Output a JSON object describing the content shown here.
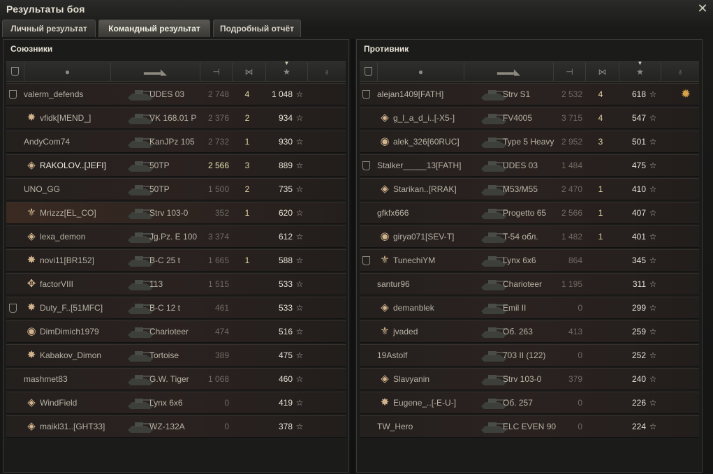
{
  "window": {
    "title": "Результаты боя",
    "close_icon": "close-icon"
  },
  "tabs": [
    {
      "label": "Личный результат",
      "active": false
    },
    {
      "label": "Командный результат",
      "active": true
    },
    {
      "label": "Подробный отчёт",
      "active": false
    }
  ],
  "header_icons": [
    "squad-icon",
    "player-icon",
    "tank-icon",
    "damage-icon",
    "kills-icon",
    "experience-star-icon",
    "medal-icon"
  ],
  "allies": {
    "title": "Союзники",
    "rows": [
      {
        "squad": true,
        "badge": "",
        "player": "valerm_defends",
        "tank": "UDES 03",
        "damage": "2 748",
        "kills": "4",
        "xp": "1 048",
        "medal": "",
        "self": false,
        "hl": false
      },
      {
        "squad": false,
        "badge": "✸",
        "player": "vfidk[MEND_]",
        "tank": "VK 168.01 P",
        "damage": "2 376",
        "kills": "2",
        "xp": "934",
        "medal": "",
        "self": false,
        "hl": false
      },
      {
        "squad": false,
        "badge": "",
        "player": "AndyCom74",
        "tank": "KanJPz 105",
        "damage": "2 732",
        "kills": "1",
        "xp": "930",
        "medal": "",
        "self": false,
        "hl": false
      },
      {
        "squad": false,
        "badge": "◈",
        "player": "RAKOLOV..[JEFI]",
        "tank": "50TP",
        "damage": "2 566",
        "kills": "3",
        "xp": "889",
        "medal": "",
        "self": false,
        "hl": true
      },
      {
        "squad": false,
        "badge": "",
        "player": "UNO_GG",
        "tank": "50TP",
        "damage": "1 500",
        "kills": "2",
        "xp": "735",
        "medal": "",
        "self": false,
        "hl": false
      },
      {
        "squad": false,
        "badge": "⚜",
        "player": "Mrizzz[EL_CO]",
        "tank": "Strv 103-0",
        "damage": "352",
        "kills": "1",
        "xp": "620",
        "medal": "",
        "self": true,
        "hl": false
      },
      {
        "squad": false,
        "badge": "◈",
        "player": "lexa_demon",
        "tank": "Jg.Pz. E 100",
        "damage": "3 374",
        "kills": "",
        "xp": "612",
        "medal": "",
        "self": false,
        "hl": false
      },
      {
        "squad": false,
        "badge": "✸",
        "player": "novi11[BR152]",
        "tank": "B-C 25 t",
        "damage": "1 665",
        "kills": "1",
        "xp": "588",
        "medal": "",
        "self": false,
        "hl": false
      },
      {
        "squad": false,
        "badge": "✥",
        "player": "factorVIII",
        "tank": "113",
        "damage": "1 515",
        "kills": "",
        "xp": "533",
        "medal": "",
        "self": false,
        "hl": false
      },
      {
        "squad": true,
        "badge": "✸",
        "player": "Duty_F..[51MFC]",
        "tank": "B-C 12 t",
        "damage": "461",
        "kills": "",
        "xp": "533",
        "medal": "",
        "self": false,
        "hl": false
      },
      {
        "squad": false,
        "badge": "◉",
        "player": "DimDimich1979",
        "tank": "Charioteer",
        "damage": "474",
        "kills": "",
        "xp": "516",
        "medal": "",
        "self": false,
        "hl": false
      },
      {
        "squad": false,
        "badge": "✸",
        "player": "Kabakov_Dimon",
        "tank": "Tortoise",
        "damage": "389",
        "kills": "",
        "xp": "475",
        "medal": "",
        "self": false,
        "hl": false
      },
      {
        "squad": false,
        "badge": "",
        "player": "mashmet83",
        "tank": "G.W. Tiger",
        "damage": "1 068",
        "kills": "",
        "xp": "460",
        "medal": "",
        "self": false,
        "hl": false
      },
      {
        "squad": false,
        "badge": "◈",
        "player": "WindField",
        "tank": "Lynx 6x6",
        "damage": "0",
        "kills": "",
        "xp": "419",
        "medal": "",
        "self": false,
        "hl": false
      },
      {
        "squad": false,
        "badge": "◈",
        "player": "maikl31..[GHT33]",
        "tank": "WZ-132A",
        "damage": "0",
        "kills": "",
        "xp": "378",
        "medal": "",
        "self": false,
        "hl": false
      }
    ]
  },
  "enemies": {
    "title": "Противник",
    "rows": [
      {
        "squad": true,
        "badge": "",
        "player": "alejan1409[FATH]",
        "tank": "Strv S1",
        "damage": "2 532",
        "kills": "4",
        "xp": "618",
        "medal": "✹",
        "self": false,
        "hl": false
      },
      {
        "squad": false,
        "badge": "◈",
        "player": "g_l_a_d_i..[-X5-]",
        "tank": "FV4005",
        "damage": "3 715",
        "kills": "4",
        "xp": "547",
        "medal": "",
        "self": false,
        "hl": false
      },
      {
        "squad": false,
        "badge": "◉",
        "player": "alek_326[60RUC]",
        "tank": "Type 5 Heavy",
        "damage": "2 952",
        "kills": "3",
        "xp": "501",
        "medal": "",
        "self": false,
        "hl": false
      },
      {
        "squad": true,
        "badge": "",
        "player": "Stalker_____13[FATH]",
        "tank": "UDES 03",
        "damage": "1 484",
        "kills": "",
        "xp": "475",
        "medal": "",
        "self": false,
        "hl": false
      },
      {
        "squad": false,
        "badge": "◈",
        "player": "Starikan..[RRAK]",
        "tank": "M53/M55",
        "damage": "2 470",
        "kills": "1",
        "xp": "410",
        "medal": "",
        "self": false,
        "hl": false
      },
      {
        "squad": false,
        "badge": "",
        "player": "gfkfx666",
        "tank": "Progetto 65",
        "damage": "2 566",
        "kills": "1",
        "xp": "407",
        "medal": "",
        "self": false,
        "hl": false
      },
      {
        "squad": false,
        "badge": "◉",
        "player": "girya071[SEV-T]",
        "tank": "T-54 обл.",
        "damage": "1 482",
        "kills": "1",
        "xp": "401",
        "medal": "",
        "self": false,
        "hl": false
      },
      {
        "squad": true,
        "badge": "⚜",
        "player": "TunechiYM",
        "tank": "Lynx 6x6",
        "damage": "864",
        "kills": "",
        "xp": "345",
        "medal": "",
        "self": false,
        "hl": false
      },
      {
        "squad": false,
        "badge": "",
        "player": "santur96",
        "tank": "Charioteer",
        "damage": "1 195",
        "kills": "",
        "xp": "311",
        "medal": "",
        "self": false,
        "hl": false
      },
      {
        "squad": false,
        "badge": "◈",
        "player": "demanblek",
        "tank": "Emil II",
        "damage": "0",
        "kills": "",
        "xp": "299",
        "medal": "",
        "self": false,
        "hl": false
      },
      {
        "squad": false,
        "badge": "⚜",
        "player": "jvaded",
        "tank": "Об. 263",
        "damage": "413",
        "kills": "",
        "xp": "259",
        "medal": "",
        "self": false,
        "hl": false
      },
      {
        "squad": false,
        "badge": "",
        "player": "19Astolf",
        "tank": "703 II (122)",
        "damage": "0",
        "kills": "",
        "xp": "252",
        "medal": "",
        "self": false,
        "hl": false
      },
      {
        "squad": false,
        "badge": "◈",
        "player": "Slavyanin",
        "tank": "Strv 103-0",
        "damage": "379",
        "kills": "",
        "xp": "240",
        "medal": "",
        "self": false,
        "hl": false
      },
      {
        "squad": false,
        "badge": "✸",
        "player": "Eugene_..[-E-U-]",
        "tank": "Об. 257",
        "damage": "0",
        "kills": "",
        "xp": "226",
        "medal": "",
        "self": false,
        "hl": false
      },
      {
        "squad": false,
        "badge": "",
        "player": "TW_Hero",
        "tank": "ELC EVEN 90",
        "damage": "0",
        "kills": "",
        "xp": "224",
        "medal": "",
        "self": false,
        "hl": false
      }
    ]
  },
  "colors": {
    "accent": "#e3d7a0",
    "highlight": "#e8e3b0",
    "self_row": "#3a2a22"
  }
}
